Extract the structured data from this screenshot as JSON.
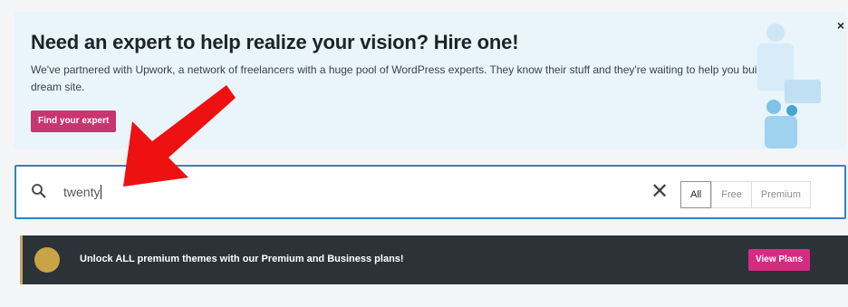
{
  "banner": {
    "title": "Need an expert to help realize your vision? Hire one!",
    "text": "We've partnered with Upwork, a network of freelancers with a huge pool of WordPress experts. They know their stuff and they're waiting to help you build your dream site.",
    "button_label": "Find your expert",
    "close_label": "×"
  },
  "search": {
    "value": "twenty",
    "clear_label": "✕",
    "filters": [
      "All",
      "Free",
      "Premium"
    ],
    "selected_filter": "All"
  },
  "upsell": {
    "text": "Unlock ALL premium themes with our Premium and Business plans!",
    "button_label": "View Plans"
  },
  "colors": {
    "accent_blue": "#3582c4",
    "brand_pink": "#c9356e",
    "annotation_red": "#ee1111",
    "dark_bar": "#2c3338"
  }
}
